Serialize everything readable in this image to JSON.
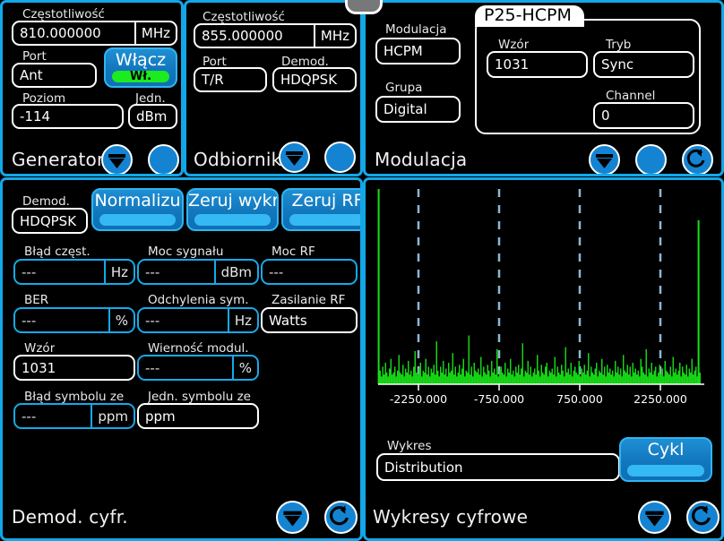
{
  "generator": {
    "title": "Generator",
    "frequency_label": "Częstotliwość",
    "frequency_value": "810.000000",
    "frequency_unit": "MHz",
    "port_label": "Port",
    "port_value": "Ant",
    "level_label": "Poziom",
    "level_value": "-114",
    "unit_label": "Jedn.",
    "unit_value": "dBm",
    "power_button_label": "Włącz",
    "power_button_state": "Wł.",
    "icons": {
      "collapse": "collapse-icon",
      "blank": "blank-circle-icon"
    }
  },
  "receiver": {
    "title": "Odbiornik",
    "frequency_label": "Częstotliwość",
    "frequency_value": "855.000000",
    "frequency_unit": "MHz",
    "port_label": "Port",
    "port_value": "T/R",
    "demod_label": "Demod.",
    "demod_value": "HDQPSK"
  },
  "modulation": {
    "title": "Modulacja",
    "modulation_label": "Modulacja",
    "modulation_value": "HCPM",
    "group_label": "Grupa",
    "group_value": "Digital",
    "groupbox_tab": "P25-HCPM",
    "pattern_label": "Wzór",
    "pattern_value": "1031",
    "mode_label": "Tryb",
    "mode_value": "Sync",
    "channel_label": "Channel",
    "channel_value": "0"
  },
  "digital_demod": {
    "title": "Demod. cyfr.",
    "demod_label": "Demod.",
    "demod_value": "HDQPSK",
    "buttons": [
      {
        "label": "Normalizu",
        "name": "normalize-button"
      },
      {
        "label": "Zeruj wykr",
        "name": "reset-chart-button"
      },
      {
        "label": "Zeruj RF",
        "name": "reset-rf-button"
      }
    ],
    "freq_error_label": "Błąd częst.",
    "freq_error_value": "---",
    "freq_error_unit": "Hz",
    "signal_power_label": "Moc sygnału",
    "signal_power_value": "---",
    "signal_power_unit": "dBm",
    "rf_power_label": "Moc RF",
    "rf_power_value": "---",
    "ber_label": "BER",
    "ber_value": "---",
    "ber_unit": "%",
    "sym_dev_label": "Odchylenia sym.",
    "sym_dev_value": "---",
    "sym_dev_unit": "Hz",
    "rf_supply_label": "Zasilanie RF",
    "rf_supply_value": "Watts",
    "pattern_label": "Wzór",
    "pattern_value": "1031",
    "mod_fidelity_label": "Wierność modul.",
    "mod_fidelity_value": "---",
    "mod_fidelity_unit": "%",
    "sym_err_label": "Błąd symbolu ze",
    "sym_err_value": "---",
    "sym_err_unit": "ppm",
    "sym_unit_label": "Jedn. symbolu ze",
    "sym_unit_value": "ppm"
  },
  "digital_charts": {
    "title": "Wykresy cyfrowe",
    "chart_select_label": "Wykres",
    "chart_select_value": "Distribution",
    "cycle_button_label": "Cykl"
  },
  "chart_data": {
    "type": "bar",
    "title": "Distribution",
    "xlabel": "",
    "ylabel": "",
    "grid": true,
    "legend": "none",
    "xticks": [
      -2250.0,
      -750.0,
      750.0,
      2250.0
    ],
    "xtick_labels": [
      "-2250.000",
      "-750.000",
      "750.000",
      "2250.000"
    ],
    "xlim": [
      -3000,
      3000
    ],
    "ylim": [
      0,
      100
    ],
    "gridlines_x": [
      -2250,
      -750,
      750,
      2250
    ],
    "series_color": "#18E018",
    "gridline_color": "#8FB7CF",
    "spikes": [
      {
        "x": -2990,
        "height": 100
      },
      {
        "x": 2960,
        "height": 84
      }
    ],
    "noise_floor": [
      3,
      7,
      4,
      9,
      5,
      11,
      6,
      4,
      8,
      13,
      5,
      6,
      9,
      4,
      7,
      15,
      6,
      5,
      10,
      4,
      8,
      6,
      12,
      5,
      7,
      4,
      9,
      17,
      6,
      5,
      8,
      11,
      4,
      7,
      6,
      13,
      5,
      9,
      4,
      8,
      6,
      10,
      5,
      22,
      7,
      4,
      9,
      6,
      12,
      5,
      8,
      4,
      11,
      6,
      7,
      16,
      5,
      9,
      4,
      6,
      10,
      5,
      8,
      13,
      4,
      7,
      6,
      25,
      5,
      9,
      4,
      11,
      7,
      6,
      8,
      5,
      14,
      4,
      9,
      6,
      5,
      10,
      7,
      4,
      12,
      6,
      8,
      5,
      18,
      4,
      7,
      9,
      6,
      5,
      11,
      4,
      8,
      6,
      13,
      5,
      7,
      4,
      9,
      6,
      10,
      5,
      8,
      21,
      4,
      7,
      6,
      12,
      5,
      9,
      4,
      6,
      8,
      5,
      15,
      7,
      4,
      10,
      6,
      5,
      9,
      11,
      4,
      7,
      6,
      8,
      5,
      14,
      4,
      9,
      6,
      5,
      10,
      7,
      4,
      19,
      6,
      8,
      5,
      11,
      4,
      7,
      9,
      6,
      5,
      12,
      4,
      8,
      6,
      10,
      5,
      7,
      16,
      4,
      9,
      6,
      5,
      8,
      11,
      4,
      7,
      6,
      13,
      5,
      9,
      4,
      10,
      6,
      8,
      5,
      7,
      4,
      12,
      6,
      9,
      5,
      8,
      4,
      15,
      7,
      6,
      10,
      5,
      9,
      4,
      11,
      6,
      8,
      5,
      7,
      4,
      13,
      9,
      6,
      5,
      18,
      4,
      8,
      6,
      11,
      5,
      7,
      9,
      4,
      6,
      10,
      5,
      8,
      4,
      12,
      7,
      6,
      5,
      9,
      4,
      14,
      6,
      8,
      5,
      7,
      11,
      4,
      9,
      6,
      5,
      10,
      4,
      8,
      6,
      13,
      5,
      7,
      9,
      4,
      22,
      6
    ]
  }
}
